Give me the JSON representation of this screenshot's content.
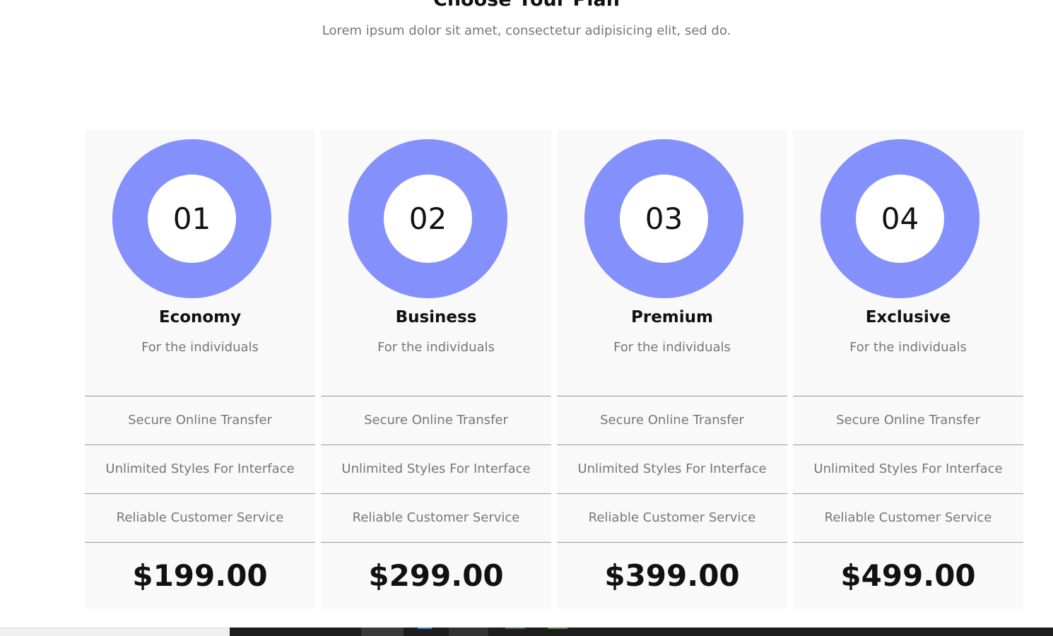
{
  "header": {
    "title": "Choose Your Plan",
    "subtitle": "Lorem ipsum dolor sit amet, consectetur adipisicing elit, sed do."
  },
  "colors": {
    "ring": "#8490fb",
    "card_background": "#f9f9f9",
    "divider": "#9a9a9a"
  },
  "plans": [
    {
      "number": "01",
      "name": "Economy",
      "audience": "For the individuals",
      "features": [
        "Secure Online Transfer",
        "Unlimited Styles For Interface",
        "Reliable Customer Service"
      ],
      "price": "$199.00"
    },
    {
      "number": "02",
      "name": "Business",
      "audience": "For the individuals",
      "features": [
        "Secure Online Transfer",
        "Unlimited Styles For Interface",
        "Reliable Customer Service"
      ],
      "price": "$299.00"
    },
    {
      "number": "03",
      "name": "Premium",
      "audience": "For the individuals",
      "features": [
        "Secure Online Transfer",
        "Unlimited Styles For Interface",
        "Reliable Customer Service"
      ],
      "price": "$399.00"
    },
    {
      "number": "04",
      "name": "Exclusive",
      "audience": "For the individuals",
      "features": [
        "Secure Online Transfer",
        "Unlimited Styles For Interface",
        "Reliable Customer Service"
      ],
      "price": "$499.00"
    }
  ]
}
